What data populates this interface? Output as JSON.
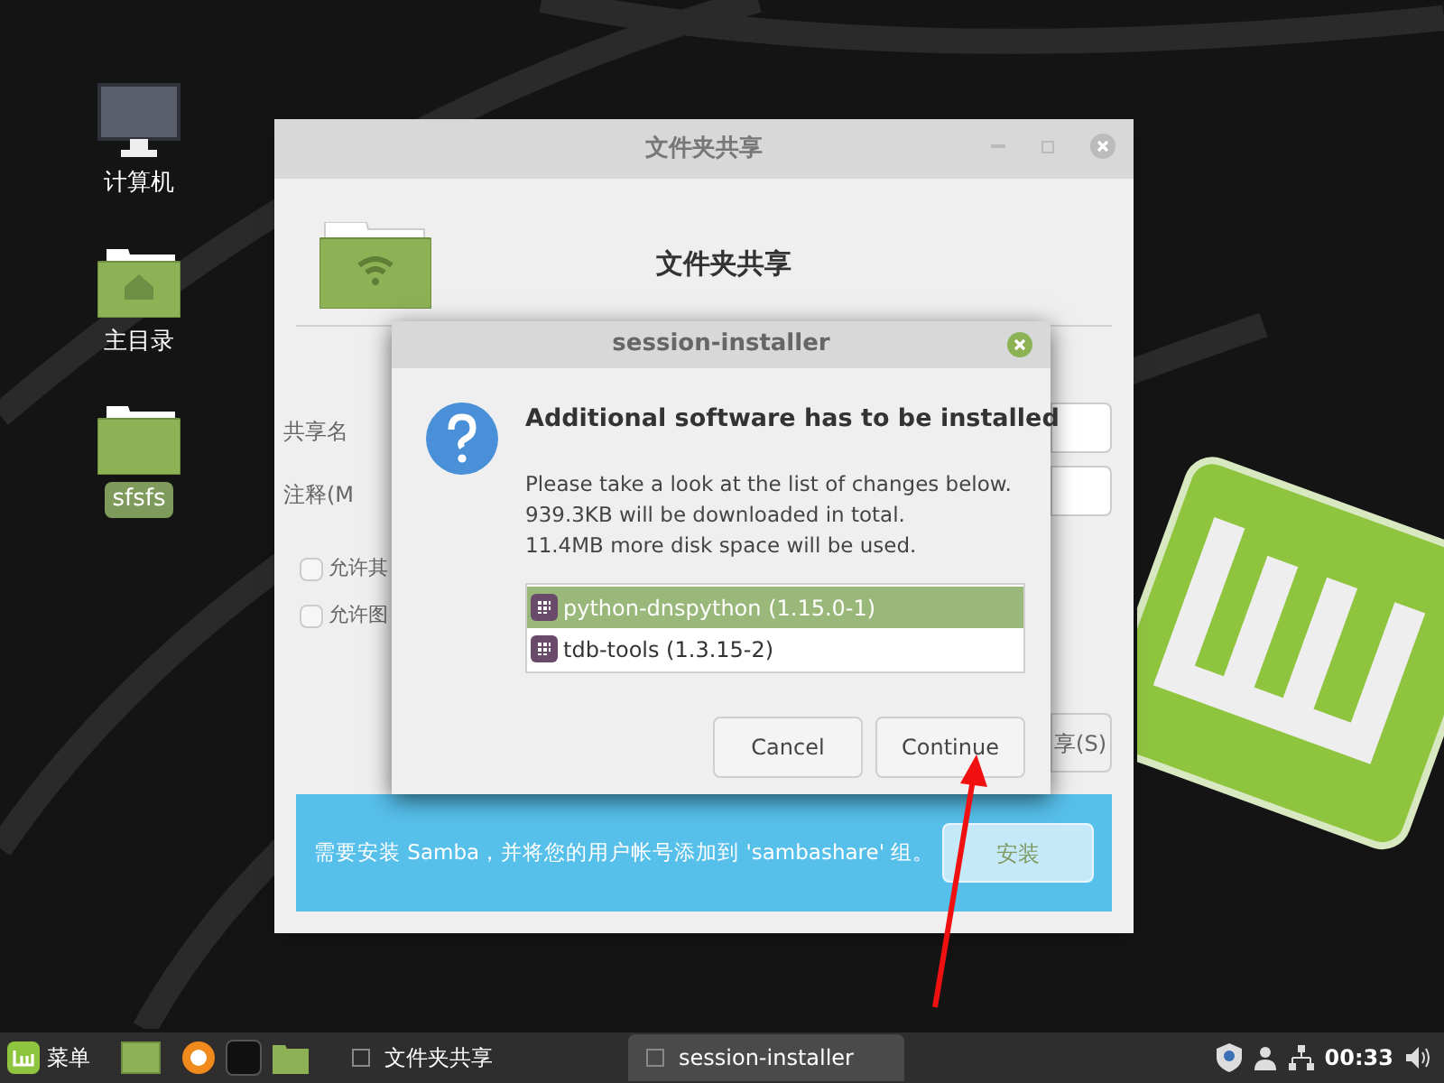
{
  "desktop_icons": [
    {
      "kind": "computer",
      "label": "计算机",
      "selected": false
    },
    {
      "kind": "home",
      "label": "主目录",
      "selected": false
    },
    {
      "kind": "folder",
      "label": "sfsfs",
      "selected": true
    }
  ],
  "share_window": {
    "title": "文件夹共享",
    "heading": "文件夹共享",
    "fields": [
      {
        "label": "共享名"
      },
      {
        "label": "注释(M"
      }
    ],
    "checkboxes": [
      {
        "label": "允许其",
        "checked": false
      },
      {
        "label": "允许图",
        "checked": false
      }
    ],
    "share_button": "享(S)",
    "info_bar": {
      "message": "需要安装 Samba，并将您的用户帐号添加到 'sambashare' 组。",
      "button": "安装",
      "button_disabled": true
    }
  },
  "dialog": {
    "title": "session-installer",
    "heading": "Additional software has to be installed",
    "body": [
      "Please take a look at the list of changes below.",
      "939.3KB will be downloaded in total.",
      "11.4MB more disk space will be used."
    ],
    "packages": [
      {
        "name": "python-dnspython (1.15.0-1)",
        "selected": true
      },
      {
        "name": "tdb-tools (1.3.15-2)",
        "selected": false
      }
    ],
    "buttons": [
      "Cancel",
      "Continue"
    ]
  },
  "taskbar": {
    "menu": "菜单",
    "windows": [
      {
        "title": "文件夹共享",
        "selected": false
      },
      {
        "title": "session-installer",
        "selected": true
      }
    ],
    "clock": "00:33"
  }
}
